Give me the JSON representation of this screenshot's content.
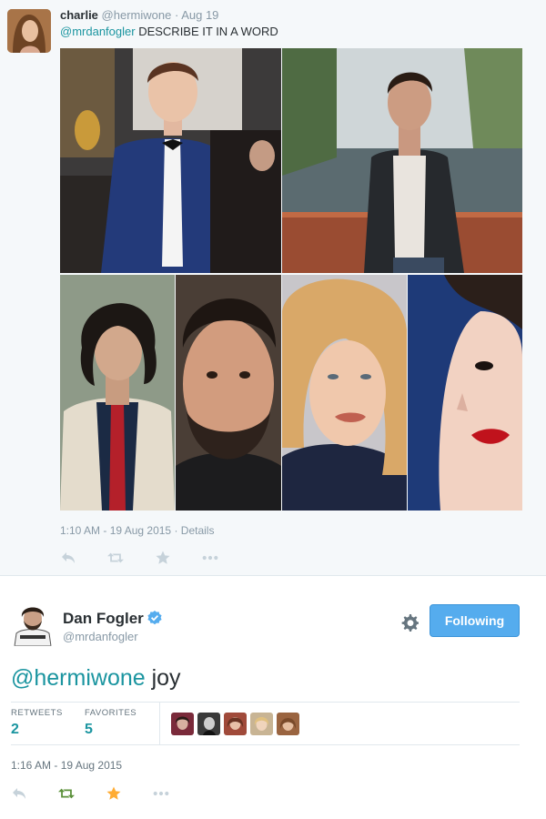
{
  "parent_tweet": {
    "name": "charlie",
    "handle": "@hermiwone",
    "separator": "·",
    "date": "Aug 19",
    "mention": "@mrdanfogler",
    "text": " DESCRIBE IT IN A WORD",
    "timestamp": "1:10 AM - 19 Aug 2015",
    "details_sep": "·",
    "details_label": "Details",
    "actions": [
      "reply-icon",
      "retweet-icon",
      "favorite-icon",
      "more-icon"
    ]
  },
  "reply_tweet": {
    "name": "Dan Fogler",
    "handle": "@mrdanfogler",
    "follow_label": "Following",
    "mention": "@hermiwone",
    "text": " joy",
    "retweets_label": "RETWEETS",
    "retweets_count": "2",
    "favorites_label": "FAVORITES",
    "favorites_count": "5",
    "timestamp": "1:16 AM - 19 Aug 2015",
    "actions": [
      "reply-icon",
      "retweet-icon",
      "favorite-icon",
      "more-icon"
    ]
  },
  "colors": {
    "link": "#1b95a0",
    "follow_button": "#55acee",
    "favorited": "#ffac33",
    "retweeted": "#5c913b",
    "muted": "#8899a6"
  }
}
